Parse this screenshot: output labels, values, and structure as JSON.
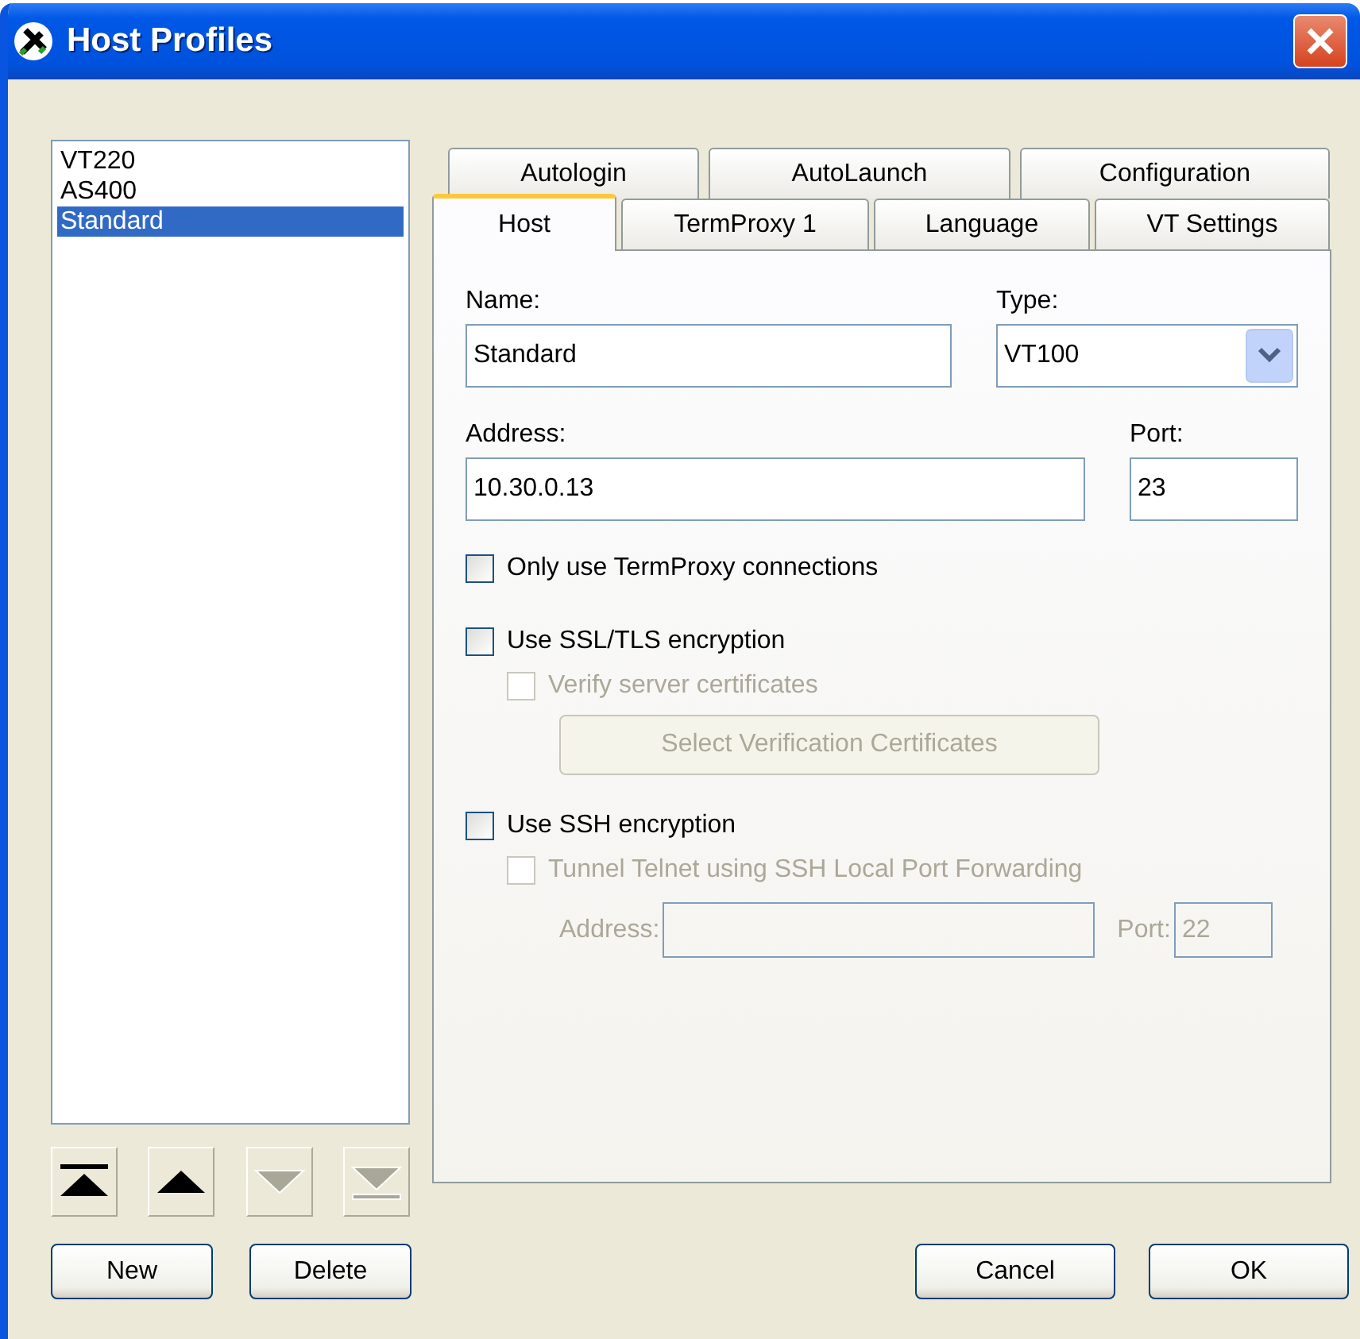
{
  "window": {
    "title": "Host Profiles"
  },
  "profiles": [
    {
      "label": "VT220",
      "selected": false
    },
    {
      "label": "AS400",
      "selected": false
    },
    {
      "label": "Standard",
      "selected": true
    }
  ],
  "move_buttons": [
    {
      "kind": "top",
      "disabled": false
    },
    {
      "kind": "up",
      "disabled": false
    },
    {
      "kind": "down",
      "disabled": true
    },
    {
      "kind": "bottom",
      "disabled": true
    }
  ],
  "list_buttons": [
    "New",
    "Delete"
  ],
  "tabs": {
    "back_row": [
      {
        "label": "Autologin",
        "selected": false
      },
      {
        "label": "AutoLaunch",
        "selected": false
      },
      {
        "label": "Configuration",
        "selected": false
      }
    ],
    "front_row": [
      {
        "label": "Host",
        "selected": true
      },
      {
        "label": "TermProxy 1",
        "selected": false
      },
      {
        "label": "Language",
        "selected": false
      },
      {
        "label": "VT Settings",
        "selected": false
      }
    ]
  },
  "host": {
    "name": {
      "label": "Name:",
      "value": "Standard"
    },
    "type": {
      "label": "Type:",
      "value": "VT100"
    },
    "address": {
      "label": "Address:",
      "value": "10.30.0.13"
    },
    "port": {
      "label": "Port:",
      "value": "23"
    }
  },
  "options": [
    {
      "kind": "checkbox",
      "label": "Only use TermProxy connections",
      "checked": false,
      "disabled": false
    },
    {
      "kind": "checkbox",
      "label": "Use SSL/TLS encryption",
      "checked": false,
      "disabled": false,
      "children": [
        {
          "kind": "checkbox",
          "label": "Verify server certificates",
          "checked": false,
          "disabled": true
        },
        {
          "kind": "button",
          "label": "Select Verification Certificates",
          "disabled": true
        }
      ]
    },
    {
      "kind": "checkbox",
      "label": "Use SSH encryption",
      "checked": false,
      "disabled": false,
      "children": [
        {
          "kind": "checkbox",
          "label": "Tunnel Telnet using SSH Local Port Forwarding",
          "checked": false,
          "disabled": true
        },
        {
          "kind": "fields",
          "disabled": true,
          "fields": [
            {
              "label": "Address:"
            },
            {
              "label": "Port:",
              "value": "22"
            }
          ]
        }
      ]
    }
  ],
  "dialog_buttons": [
    "Cancel",
    "OK"
  ]
}
